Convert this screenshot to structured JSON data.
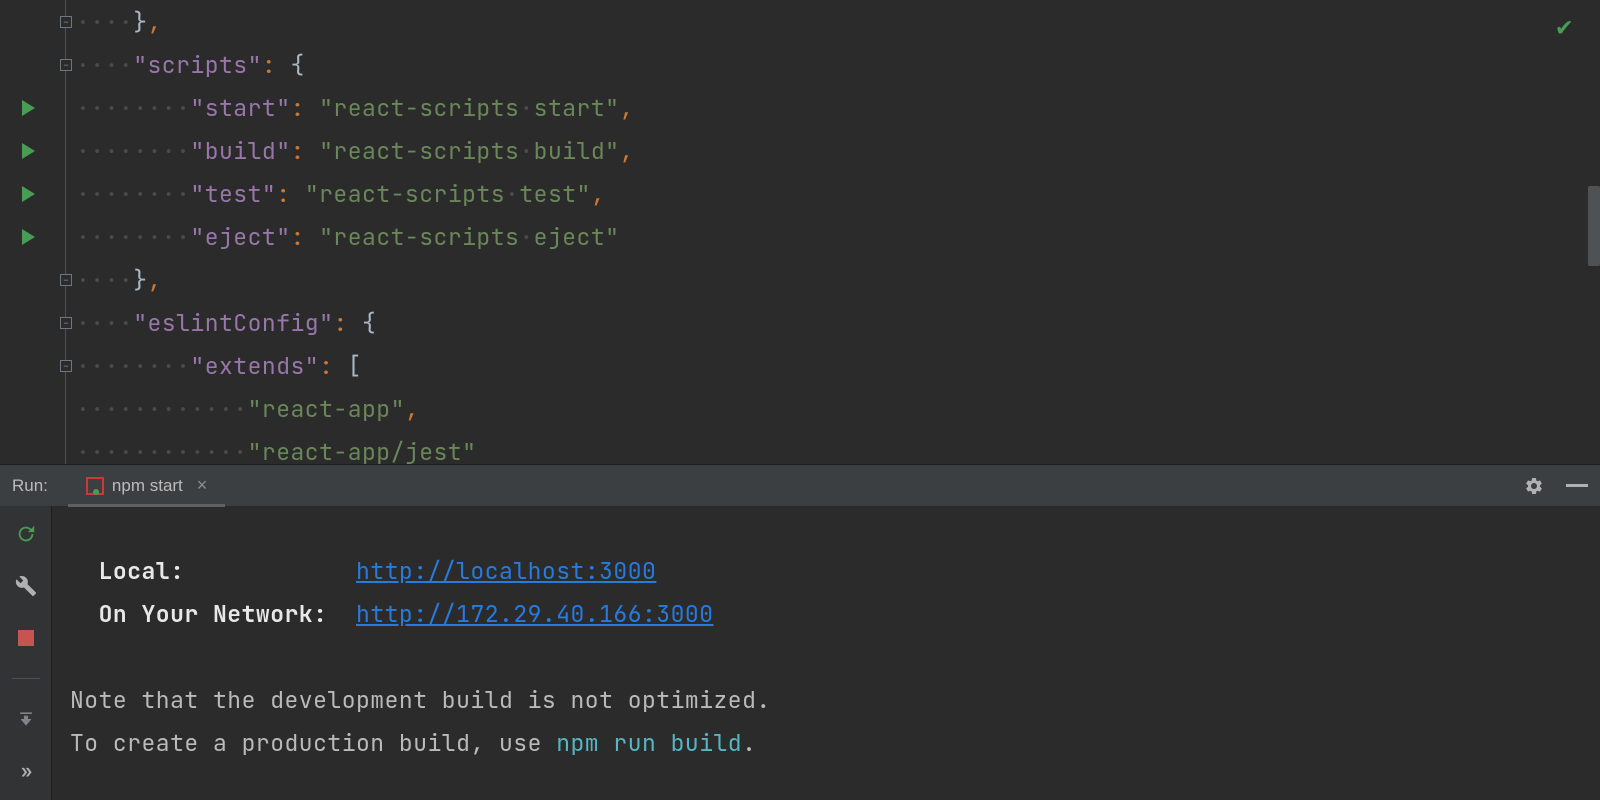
{
  "editor": {
    "lines": [
      {
        "indent": 1,
        "gutter": "fold-minus",
        "tokens": [
          {
            "t": "brace",
            "v": "}"
          },
          {
            "t": "punc",
            "v": ","
          }
        ]
      },
      {
        "indent": 1,
        "gutter": "fold-minus",
        "tokens": [
          {
            "t": "key",
            "v": "\"scripts\""
          },
          {
            "t": "punc",
            "v": ": "
          },
          {
            "t": "brace",
            "v": "{"
          }
        ]
      },
      {
        "indent": 2,
        "gutter": "run",
        "tokens": [
          {
            "t": "key",
            "v": "\"start\""
          },
          {
            "t": "punc",
            "v": ": "
          },
          {
            "t": "str",
            "v": "\"react-scripts·start\""
          },
          {
            "t": "punc",
            "v": ","
          }
        ]
      },
      {
        "indent": 2,
        "gutter": "run",
        "tokens": [
          {
            "t": "key",
            "v": "\"build\""
          },
          {
            "t": "punc",
            "v": ": "
          },
          {
            "t": "str",
            "v": "\"react-scripts·build\""
          },
          {
            "t": "punc",
            "v": ","
          }
        ]
      },
      {
        "indent": 2,
        "gutter": "run",
        "tokens": [
          {
            "t": "key",
            "v": "\"test\""
          },
          {
            "t": "punc",
            "v": ": "
          },
          {
            "t": "str",
            "v": "\"react-scripts·test\""
          },
          {
            "t": "punc",
            "v": ","
          }
        ]
      },
      {
        "indent": 2,
        "gutter": "run",
        "tokens": [
          {
            "t": "key",
            "v": "\"eject\""
          },
          {
            "t": "punc",
            "v": ": "
          },
          {
            "t": "str",
            "v": "\"react-scripts·eject\""
          }
        ]
      },
      {
        "indent": 1,
        "gutter": "fold-minus",
        "tokens": [
          {
            "t": "brace",
            "v": "}"
          },
          {
            "t": "punc",
            "v": ","
          }
        ]
      },
      {
        "indent": 1,
        "gutter": "fold-minus",
        "tokens": [
          {
            "t": "key",
            "v": "\"eslintConfig\""
          },
          {
            "t": "punc",
            "v": ": "
          },
          {
            "t": "brace",
            "v": "{"
          }
        ]
      },
      {
        "indent": 2,
        "gutter": "fold-minus",
        "tokens": [
          {
            "t": "key",
            "v": "\"extends\""
          },
          {
            "t": "punc",
            "v": ": "
          },
          {
            "t": "brace",
            "v": "["
          }
        ]
      },
      {
        "indent": 3,
        "gutter": "",
        "tokens": [
          {
            "t": "str",
            "v": "\"react-app\""
          },
          {
            "t": "punc",
            "v": ","
          }
        ]
      },
      {
        "indent": 3,
        "gutter": "",
        "tokens": [
          {
            "t": "str",
            "v": "\"react-app/jest\""
          }
        ]
      }
    ]
  },
  "runPanel": {
    "label": "Run:",
    "tabName": "npm start",
    "output": {
      "localLabel": "Local:",
      "localUrl": "http://localhost:3000",
      "networkLabel": "On Your Network:",
      "networkUrl": "http://172.29.40.166:3000",
      "note1": "Note that the development build is not optimized.",
      "note2a": "To create a production build, use ",
      "note2b": "npm run build",
      "note2c": "."
    }
  }
}
